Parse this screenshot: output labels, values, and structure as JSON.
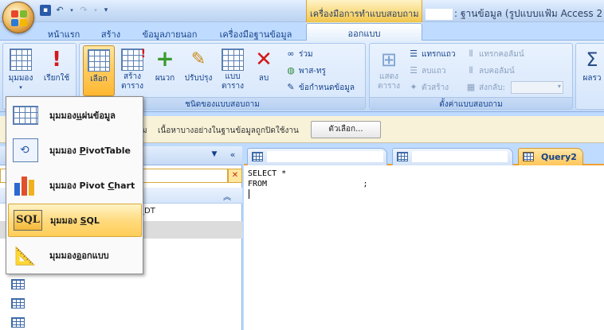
{
  "titlebar": {
    "context_title": "เครื่องมือการทำแบบสอบถาม",
    "window_title": ": ฐานข้อมูล (รูปแบบแฟ้ม Access 2"
  },
  "tabs": [
    {
      "label": "หน้าแรก"
    },
    {
      "label": "สร้าง"
    },
    {
      "label": "ข้อมูลภายนอก"
    },
    {
      "label": "เครื่องมือฐานข้อมูล"
    },
    {
      "label": "ออกแบบ"
    }
  ],
  "ribbon": {
    "view_label": "มุมมอง",
    "run_label": "เรียกใช้",
    "select_label": "เลือก",
    "make_table_label": "สร้าง\nตาราง",
    "append_label": "ผนวก",
    "update_label": "ปรับปรุง",
    "crosstab_label": "แบบ\nตาราง",
    "delete_label": "ลบ",
    "union_label": "ร่วม",
    "passthrough_label": "พาส-ทรู",
    "data_definition_label": "ข้อกำหนดข้อมูล",
    "query_type_group": "ชนิดของแบบสอบถาม",
    "show_table_label": "แสดง\nตาราง",
    "insert_rows_label": "แทรกแถว",
    "delete_rows_label": "ลบแถว",
    "builder_label": "ตัวสร้าง",
    "insert_columns_label": "แทรกคอลัมน์",
    "delete_columns_label": "ลบคอลัมน์",
    "return_label": "ส่งกลับ:",
    "query_setup_group": "ตั้งค่าแบบสอบถาม",
    "totals_label": "ผลรว"
  },
  "msgbar": {
    "text_prefix": "ม",
    "text": "เนื้อหาบางอย่างในฐานข้อมูลถูกปิดใช้งาน",
    "options_button": "ตัวเลือก..."
  },
  "nav": {
    "item_text": "_DT"
  },
  "document": {
    "active_tab": "Query2",
    "sql_text": "SELECT *\nFROM                    ;"
  },
  "menu": {
    "datasheet_prefix": "มุมมอง",
    "datasheet_underlined": "แ",
    "datasheet_suffix": "ผ่นข้อมูล",
    "pivottable_prefix": "มุมมอง ",
    "pivottable_underlined": "P",
    "pivottable_suffix": "ivotTable",
    "pivotchart_prefix": "มุมมอง Pivot ",
    "pivotchart_underlined": "C",
    "pivotchart_suffix": "hart",
    "sql_prefix": "มุมมอง ",
    "sql_underlined": "S",
    "sql_suffix": "QL",
    "design_prefix": "มุมมอง",
    "design_underlined": "อ",
    "design_suffix": "อกแบบ",
    "sql_icon_text": "SQL"
  },
  "colors": {
    "accent": "#ffc659",
    "ribbon": "#d1e3fa",
    "frame": "#bfdbff"
  }
}
